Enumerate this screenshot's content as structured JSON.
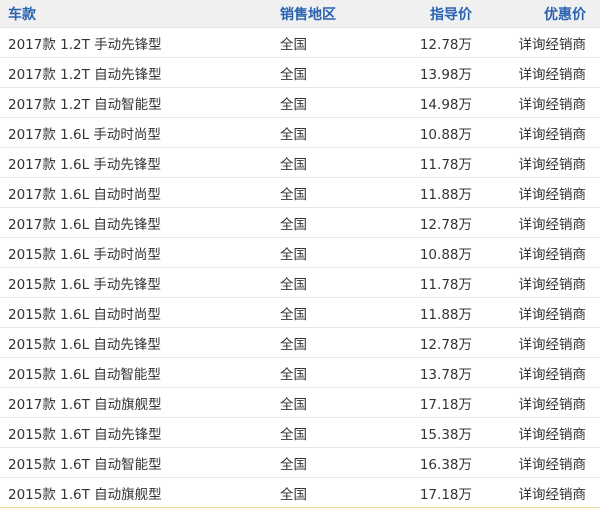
{
  "columns": {
    "model": "车款",
    "region": "销售地区",
    "price": "指导价",
    "deal": "优惠价"
  },
  "rows": [
    {
      "model": "2017款 1.2T 手动先锋型",
      "region": "全国",
      "price": "12.78万",
      "deal": "详询经销商"
    },
    {
      "model": "2017款 1.2T 自动先锋型",
      "region": "全国",
      "price": "13.98万",
      "deal": "详询经销商"
    },
    {
      "model": "2017款 1.2T 自动智能型",
      "region": "全国",
      "price": "14.98万",
      "deal": "详询经销商"
    },
    {
      "model": "2017款 1.6L 手动时尚型",
      "region": "全国",
      "price": "10.88万",
      "deal": "详询经销商"
    },
    {
      "model": "2017款 1.6L 手动先锋型",
      "region": "全国",
      "price": "11.78万",
      "deal": "详询经销商"
    },
    {
      "model": "2017款 1.6L 自动时尚型",
      "region": "全国",
      "price": "11.88万",
      "deal": "详询经销商"
    },
    {
      "model": "2017款 1.6L 自动先锋型",
      "region": "全国",
      "price": "12.78万",
      "deal": "详询经销商"
    },
    {
      "model": "2015款 1.6L 手动时尚型",
      "region": "全国",
      "price": "10.88万",
      "deal": "详询经销商"
    },
    {
      "model": "2015款 1.6L 手动先锋型",
      "region": "全国",
      "price": "11.78万",
      "deal": "详询经销商"
    },
    {
      "model": "2015款 1.6L 自动时尚型",
      "region": "全国",
      "price": "11.88万",
      "deal": "详询经销商"
    },
    {
      "model": "2015款 1.6L 自动先锋型",
      "region": "全国",
      "price": "12.78万",
      "deal": "详询经销商"
    },
    {
      "model": "2015款 1.6L 自动智能型",
      "region": "全国",
      "price": "13.78万",
      "deal": "详询经销商"
    },
    {
      "model": "2017款 1.6T 自动旗舰型",
      "region": "全国",
      "price": "17.18万",
      "deal": "详询经销商"
    },
    {
      "model": "2015款 1.6T 自动先锋型",
      "region": "全国",
      "price": "15.38万",
      "deal": "详询经销商"
    },
    {
      "model": "2015款 1.6T 自动智能型",
      "region": "全国",
      "price": "16.38万",
      "deal": "详询经销商"
    },
    {
      "model": "2015款 1.6T 自动旗舰型",
      "region": "全国",
      "price": "17.18万",
      "deal": "详询经销商"
    }
  ],
  "colors": {
    "header_text": "#2a62b1",
    "header_bg": "#f0f0f0",
    "body_text": "#333333",
    "row_divider": "#e6e6e6",
    "bottom_border": "#f0d98f"
  }
}
